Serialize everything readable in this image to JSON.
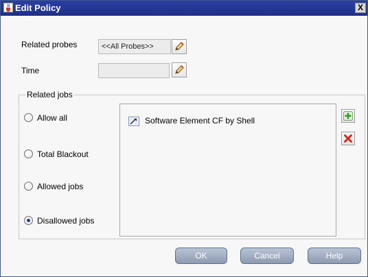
{
  "window": {
    "title": "Edit Policy",
    "close_label": "X"
  },
  "form": {
    "related_probes_label": "Related probes",
    "related_probes_value": "<<All Probes>>",
    "time_label": "Time",
    "time_value": ""
  },
  "related_jobs": {
    "legend": "Related jobs",
    "options": [
      {
        "label": "Allow all",
        "selected": false
      },
      {
        "label": "Total Blackout",
        "selected": false
      },
      {
        "label": "Allowed jobs",
        "selected": false
      },
      {
        "label": "Disallowed jobs",
        "selected": true
      }
    ],
    "jobs": [
      {
        "label": "Software Element CF by Shell",
        "icon": "job-icon"
      }
    ]
  },
  "buttons": {
    "ok": "OK",
    "cancel": "Cancel",
    "help": "Help"
  },
  "colors": {
    "titlebar": "#2b3fa0",
    "add_green": "#2f9a2f",
    "remove_red": "#d22b1f",
    "button_gradient_top": "#b9c5d6"
  }
}
